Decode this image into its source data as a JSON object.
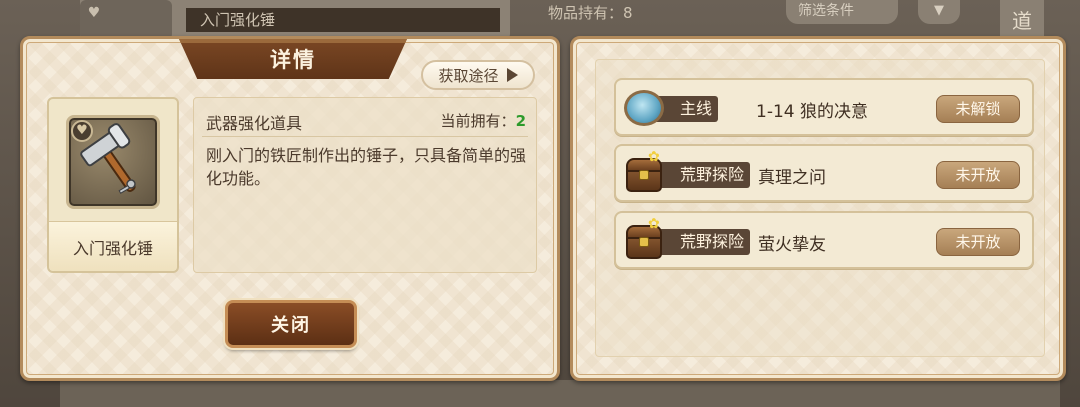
{
  "background": {
    "item_name": "入门强化锤",
    "held_label": "物品持有：8",
    "filter_label": "筛选条件",
    "side_tab": "道"
  },
  "detail_panel": {
    "title": "详情",
    "acquire_label": "获取途径",
    "item": {
      "name": "入门强化锤",
      "type": "武器强化道具",
      "owned_label": "当前拥有：",
      "owned_count": "2",
      "description": "刚入门的铁匠制作出的锤子，只具备简单的强化功能。"
    },
    "close_label": "关闭"
  },
  "routes_panel": {
    "routes": [
      {
        "tag": "主线",
        "title": "1-14 狼的决意",
        "status": "未解锁",
        "icon": "blue-orb-icon"
      },
      {
        "tag": "荒野探险",
        "title": "真理之问",
        "status": "未开放",
        "icon": "treasure-chest-icon"
      },
      {
        "tag": "荒野探险",
        "title": "萤火挚友",
        "status": "未开放",
        "icon": "treasure-chest-icon"
      }
    ]
  },
  "colors": {
    "accent_brown": "#5c2f14",
    "owned_count": "#2d9a2b",
    "status_button": "#a57f55"
  }
}
